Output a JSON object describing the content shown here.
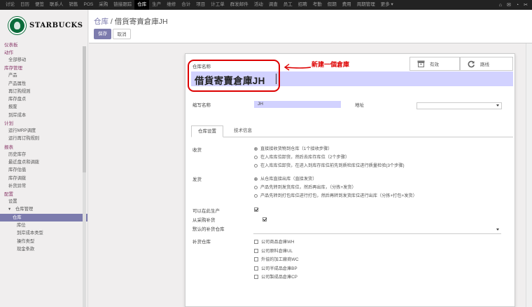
{
  "topbar": {
    "menu": [
      "讨论",
      "日历",
      "便签",
      "联系人",
      "销售",
      "POS",
      "采购",
      "链接跟踪",
      "仓库",
      "生产",
      "维修",
      "合计",
      "项目",
      "计工单",
      "群发邮件",
      "活动",
      "调查",
      "员工",
      "招聘",
      "考勤",
      "假期",
      "费用",
      "周期管理",
      "更多 ▾"
    ],
    "active_index": 8,
    "right_icons": [
      "⌂",
      "✉",
      "◔",
      "✂"
    ]
  },
  "sidebar": {
    "brand": "STARBUCKS",
    "sections": [
      {
        "head": "仪表板",
        "items": []
      },
      {
        "head": "动作",
        "items": [
          "全部移动"
        ]
      },
      {
        "head": "库存管理",
        "items": [
          "产品",
          "产品属性",
          "再订购规则",
          "库存盘点",
          "报废",
          "到岸成本"
        ]
      },
      {
        "head": "计划",
        "items": [
          "运行MRP调度",
          "运行再订购规则"
        ]
      },
      {
        "head": "报表",
        "items": [
          "历史库存",
          "最近盘点和调拨",
          "库存估值",
          "库存调拨",
          "补货异常"
        ]
      },
      {
        "head": "配置",
        "items": [
          "设置"
        ]
      }
    ],
    "warehouse_mgmt": {
      "label": "仓库管理",
      "items": [
        "仓库",
        "库位",
        "到岸成本类型",
        "操作类型",
        "现金条款"
      ],
      "active": "仓库"
    }
  },
  "control": {
    "breadcrumb_parent": "仓库",
    "breadcrumb_sep": " / ",
    "breadcrumb_current": "借貨寄賣倉庫JH",
    "save_label": "保存",
    "cancel_label": "取消"
  },
  "form": {
    "name_label": "仓库名称",
    "name_value": "借貨寄賣倉庫JH",
    "annotation": "新建一個倉庫",
    "stat_active": "有效",
    "stat_routes": "路线",
    "short_name_label": "缩写名称",
    "short_name_value": "JH",
    "address_label": "地址",
    "address_value": "",
    "tabs": [
      "仓库设置",
      "技术信息"
    ],
    "receipt_label": "收货",
    "receipt_options": [
      "直接接收货物到仓库（1个接收步骤）",
      "在入库库位卸货，然后去库存库位（2个步骤）",
      "在入库库位卸货，在进入到库存库位前先到质检库位进行质量检验(3个步骤)"
    ],
    "delivery_label": "发货",
    "delivery_options": [
      "从仓库直接出库（直接发货）",
      "产品先转到发货库位，然后再出库，（分拣+发货）",
      "产品先转到打包库位进行打包，然后再转到发货库位进行出库（分拣+打包+发货）"
    ],
    "manufacture_label": "可以在此生产",
    "buy_label": "从采购补货",
    "default_resupply_label": "默认的补货仓库",
    "resupply_label": "补货仓库",
    "resupply_options": [
      "公司商品倉庫WH",
      "公司原料倉庫UL",
      "外協的加工廠商WC",
      "公司半成品倉庫BP",
      "公司製成品倉庫CP"
    ]
  }
}
